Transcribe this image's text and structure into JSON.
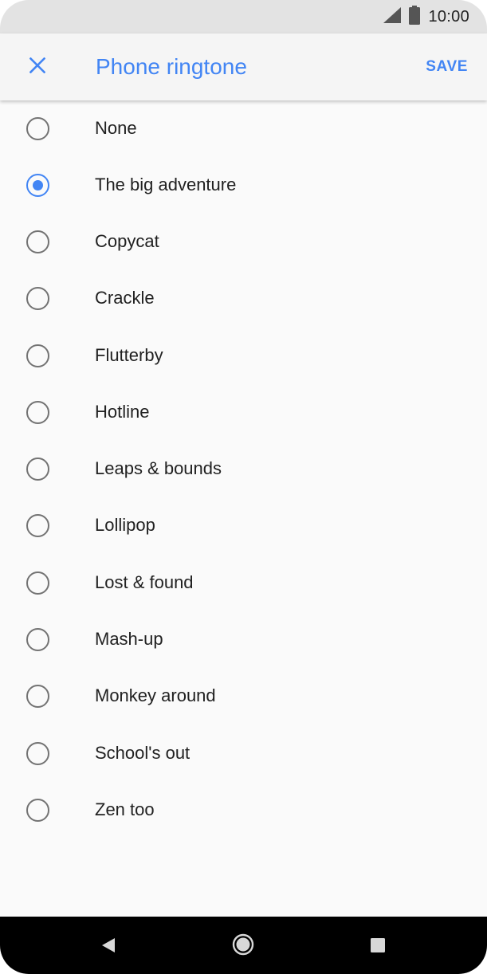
{
  "status_bar": {
    "time": "10:00",
    "icons": [
      "signal-icon",
      "battery-icon"
    ]
  },
  "app_bar": {
    "close_icon": "close-icon",
    "title": "Phone ringtone",
    "save_label": "SAVE"
  },
  "ringtones": {
    "selected": "The big adventure",
    "items": [
      {
        "label": "None",
        "checked": false
      },
      {
        "label": "The big adventure",
        "checked": true
      },
      {
        "label": "Copycat",
        "checked": false
      },
      {
        "label": "Crackle",
        "checked": false
      },
      {
        "label": "Flutterby",
        "checked": false
      },
      {
        "label": "Hotline",
        "checked": false
      },
      {
        "label": "Leaps & bounds",
        "checked": false
      },
      {
        "label": "Lollipop",
        "checked": false
      },
      {
        "label": "Lost & found",
        "checked": false
      },
      {
        "label": "Mash-up",
        "checked": false
      },
      {
        "label": "Monkey around",
        "checked": false
      },
      {
        "label": "School's out",
        "checked": false
      },
      {
        "label": "Zen too",
        "checked": false
      }
    ]
  },
  "nav_bar": {
    "icons": [
      "back-icon",
      "home-icon",
      "recents-icon"
    ]
  },
  "colors": {
    "accent": "#4285f4",
    "status_bar_bg": "#e3e3e3",
    "app_bar_bg": "#f5f5f5",
    "list_bg": "#fafafa",
    "text": "#212121",
    "radio_unchecked": "#737373",
    "nav_bar_bg": "#000000"
  }
}
